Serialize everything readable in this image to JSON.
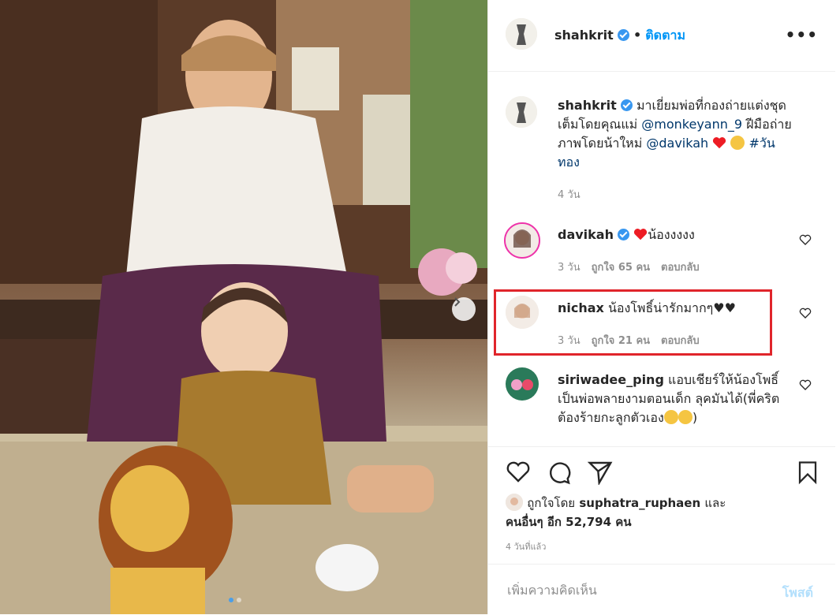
{
  "post": {
    "author": "shahkrit",
    "follow_label": "ติดตาม",
    "separator": "•",
    "more_label": "•••"
  },
  "caption": {
    "username": "shahkrit",
    "text1": "มาเยี่ยมพ่อที่กองถ่ายแต่งชุดเต็มโดยคุณแม่",
    "mention1": "@monkeyann_9",
    "text2": "ฝีมือถ่ายภาพโดยน้าใหม่",
    "mention2": "@davikah",
    "hashtag": "#วันทอง",
    "age": "4 วัน"
  },
  "comments": [
    {
      "username": "davikah",
      "text": "น้องงงงง",
      "age": "3 วัน",
      "likes": "ถูกใจ 65 คน",
      "reply": "ตอบกลับ"
    },
    {
      "username": "nichax",
      "text": "น้องโพธิ์น่ารักมากๆ♥♥",
      "age": "3 วัน",
      "likes": "ถูกใจ 21 คน",
      "reply": "ตอบกลับ"
    },
    {
      "username": "siriwadee_ping",
      "text": "แอบเชียร์ให้น้องโพธิ์เป็นพ่อพลายงามตอนเด็ก ลุคมันได้(พี่คริตต้องร้ายกะลูกตัวเอง",
      "text_end": ")"
    }
  ],
  "likes": {
    "prefix": "ถูกใจโดย",
    "user": "suphatra_ruphaen",
    "conj": "และ",
    "others": "คนอื่นๆ อีก 52,794 คน"
  },
  "timestamp": "4 วันที่แล้ว",
  "add_comment": {
    "placeholder": "เพิ่มความคิดเห็น",
    "post_label": "โพสต์"
  },
  "colors": {
    "accent": "#0095f6",
    "highlight": "#e0252b",
    "heart": "#ed1c24"
  },
  "icons": [
    "chevron-right-icon",
    "heart-icon",
    "comment-icon",
    "share-icon",
    "bookmark-icon",
    "verified-icon"
  ]
}
